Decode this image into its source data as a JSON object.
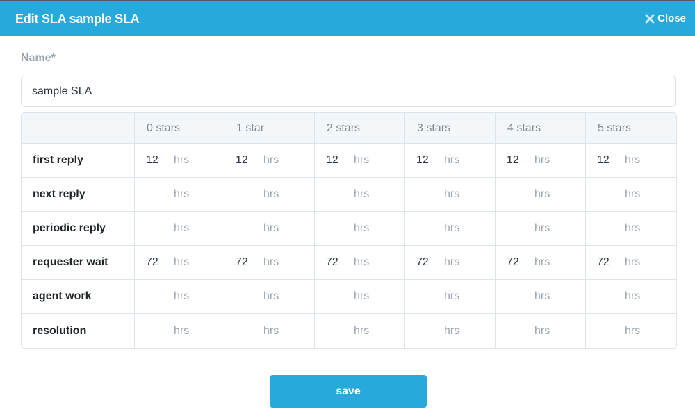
{
  "dialog": {
    "title": "Edit SLA sample SLA",
    "close_label": "Close"
  },
  "form": {
    "name_label": "Name*",
    "name_value": "sample SLA"
  },
  "table": {
    "corner_header": "",
    "columns": [
      "0 stars",
      "1 star",
      "2 stars",
      "3 stars",
      "4 stars",
      "5 stars"
    ],
    "unit": "hrs",
    "rows": [
      {
        "label": "first reply",
        "values": [
          "12",
          "12",
          "12",
          "12",
          "12",
          "12"
        ]
      },
      {
        "label": "next reply",
        "values": [
          "",
          "",
          "",
          "",
          "",
          ""
        ]
      },
      {
        "label": "periodic reply",
        "values": [
          "",
          "",
          "",
          "",
          "",
          ""
        ]
      },
      {
        "label": "requester wait",
        "values": [
          "72",
          "72",
          "72",
          "72",
          "72",
          "72"
        ]
      },
      {
        "label": "agent work",
        "values": [
          "",
          "",
          "",
          "",
          "",
          ""
        ]
      },
      {
        "label": "resolution",
        "values": [
          "",
          "",
          "",
          "",
          "",
          ""
        ]
      }
    ]
  },
  "actions": {
    "save_label": "save"
  }
}
